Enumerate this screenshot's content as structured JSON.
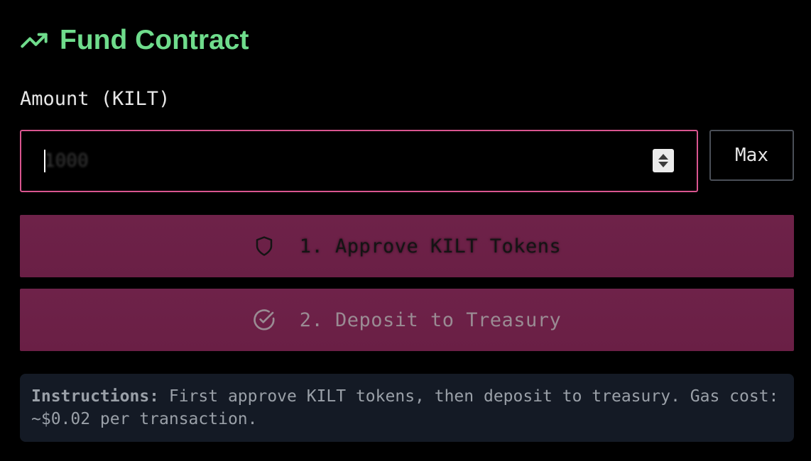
{
  "header": {
    "icon": "trending-up-icon",
    "title": "Fund Contract",
    "title_color": "#6fdc8c"
  },
  "amount": {
    "label": "Amount (KILT)",
    "placeholder": "1000",
    "value": "",
    "max_label": "Max",
    "focus_border_color": "#d9558f"
  },
  "actions": {
    "approve": {
      "icon": "shield-icon",
      "label": "1. Approve KILT Tokens"
    },
    "deposit": {
      "icon": "check-circle-icon",
      "label": "2. Deposit to Treasury"
    },
    "button_color": "#6b2047"
  },
  "instructions": {
    "heading": "Instructions:",
    "text": " First approve KILT tokens, then deposit to treasury. Gas cost: ~$0.02 per transaction."
  }
}
